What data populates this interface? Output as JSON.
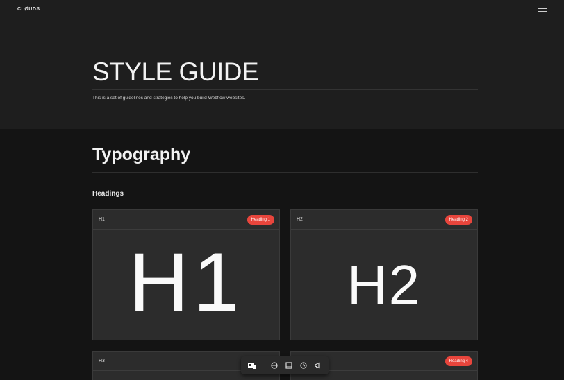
{
  "header": {
    "logo": "CLØUDS",
    "menu_icon": "hamburger-menu-icon"
  },
  "hero": {
    "title": "STYLE GUIDE",
    "description": "This is a set of guidelines and strategies to help you build Webflow websites."
  },
  "typography": {
    "title": "Typography",
    "headings_label": "Headings",
    "cards": [
      {
        "label": "H1",
        "badge": "Heading 1",
        "sample": "H1"
      },
      {
        "label": "H2",
        "badge": "Heading 2",
        "sample": "H2"
      },
      {
        "label": "H3",
        "badge": "",
        "sample": ""
      },
      {
        "label": "",
        "badge": "Heading 4",
        "sample": ""
      }
    ]
  },
  "toolbar": {
    "items": [
      "webflow-logo-icon",
      "globe-icon",
      "panel-icon",
      "clock-icon",
      "megaphone-icon"
    ]
  },
  "colors": {
    "accent": "#e8453c",
    "hero_bg": "#1e1e1e",
    "page_bg": "#141414",
    "card_bg": "#2c2c2c"
  }
}
